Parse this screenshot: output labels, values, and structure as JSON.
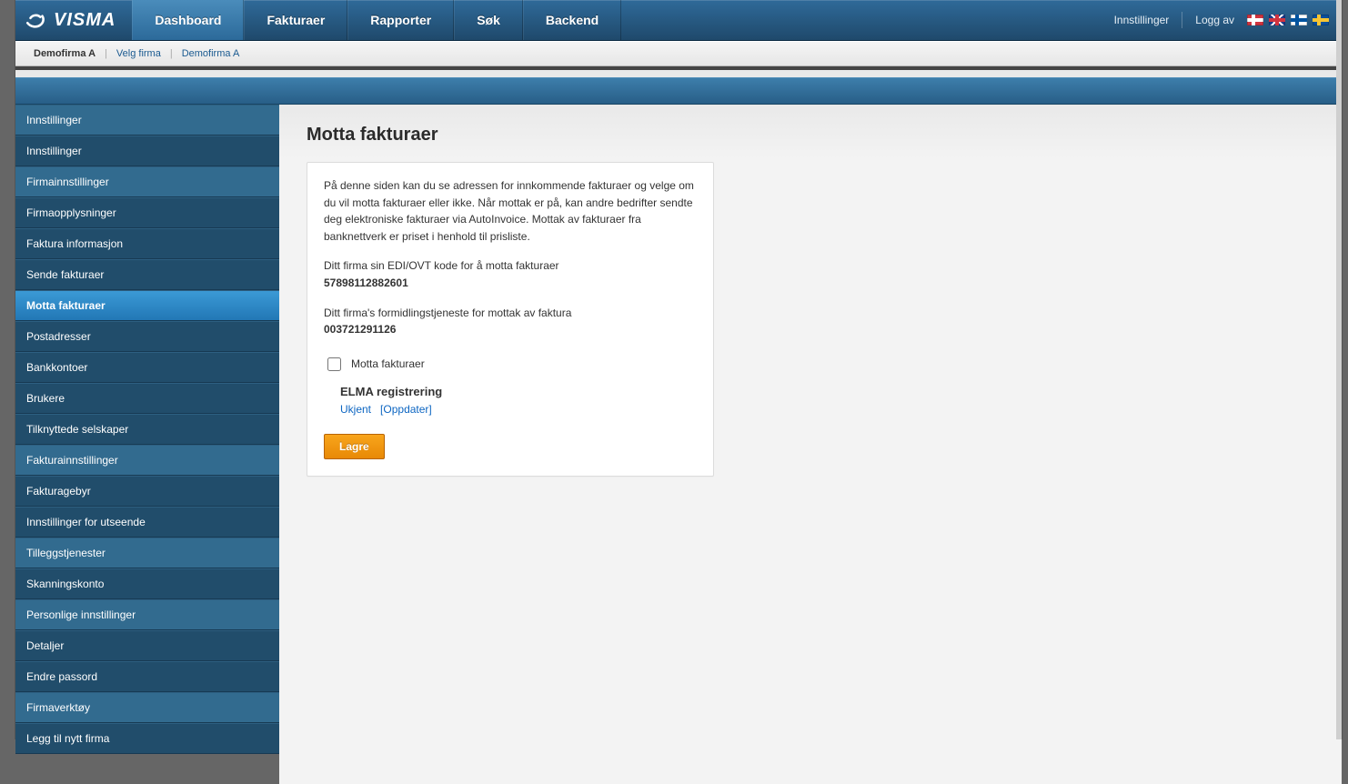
{
  "brand": "VISMA",
  "topnav": {
    "tabs": [
      {
        "id": "dashboard",
        "label": "Dashboard",
        "active": true
      },
      {
        "id": "fakturaer",
        "label": "Fakturaer"
      },
      {
        "id": "rapporter",
        "label": "Rapporter"
      },
      {
        "id": "sok",
        "label": "Søk"
      },
      {
        "id": "backend",
        "label": "Backend"
      }
    ],
    "settings_label": "Innstillinger",
    "logout_label": "Logg av"
  },
  "flags": [
    "no",
    "en",
    "fi",
    "se"
  ],
  "breadcrumb": {
    "firm": "Demofirma A",
    "choose_firm": "Velg firma",
    "firm_again": "Demofirma A"
  },
  "sidebar": [
    {
      "type": "header",
      "label": "Innstillinger"
    },
    {
      "type": "item",
      "label": "Innstillinger"
    },
    {
      "type": "header",
      "label": "Firmainnstillinger"
    },
    {
      "type": "item",
      "label": "Firmaopplysninger"
    },
    {
      "type": "item",
      "label": "Faktura informasjon"
    },
    {
      "type": "item",
      "label": "Sende fakturaer"
    },
    {
      "type": "item",
      "label": "Motta fakturaer",
      "selected": true
    },
    {
      "type": "item",
      "label": "Postadresser"
    },
    {
      "type": "item",
      "label": "Bankkontoer"
    },
    {
      "type": "item",
      "label": "Brukere"
    },
    {
      "type": "item",
      "label": "Tilknyttede selskaper"
    },
    {
      "type": "header",
      "label": "Fakturainnstillinger"
    },
    {
      "type": "item",
      "label": "Fakturagebyr"
    },
    {
      "type": "item",
      "label": "Innstillinger for utseende"
    },
    {
      "type": "header",
      "label": "Tilleggstjenester"
    },
    {
      "type": "item",
      "label": "Skanningskonto"
    },
    {
      "type": "header",
      "label": "Personlige innstillinger"
    },
    {
      "type": "item",
      "label": "Detaljer"
    },
    {
      "type": "item",
      "label": "Endre passord"
    },
    {
      "type": "header",
      "label": "Firmaverktøy"
    },
    {
      "type": "item",
      "label": "Legg til nytt firma"
    }
  ],
  "page": {
    "title": "Motta fakturaer",
    "intro": "På denne siden kan du se adressen for innkommende fakturaer og velge om du vil motta fakturaer eller ikke. Når mottak er på, kan andre bedrifter sendte deg elektroniske fakturaer via AutoInvoice. Mottak av fakturaer fra banknettverk er priset i henhold til prisliste.",
    "edi_label": "Ditt firma sin EDI/OVT kode for å motta fakturaer",
    "edi_value": "57898112882601",
    "operator_label": "Ditt firma's formidlingstjeneste for mottak av faktura",
    "operator_value": "003721291126",
    "checkbox_label": "Motta fakturaer",
    "checkbox_checked": false,
    "elma_title": "ELMA registrering",
    "elma_status": "Ukjent",
    "elma_update": "[Oppdater]",
    "save_label": "Lagre"
  },
  "colors": {
    "accent_blue": "#2b6a9a",
    "selected_blue": "#2a87c6",
    "save_orange": "#ef8c10",
    "link_blue": "#0d66c2"
  }
}
